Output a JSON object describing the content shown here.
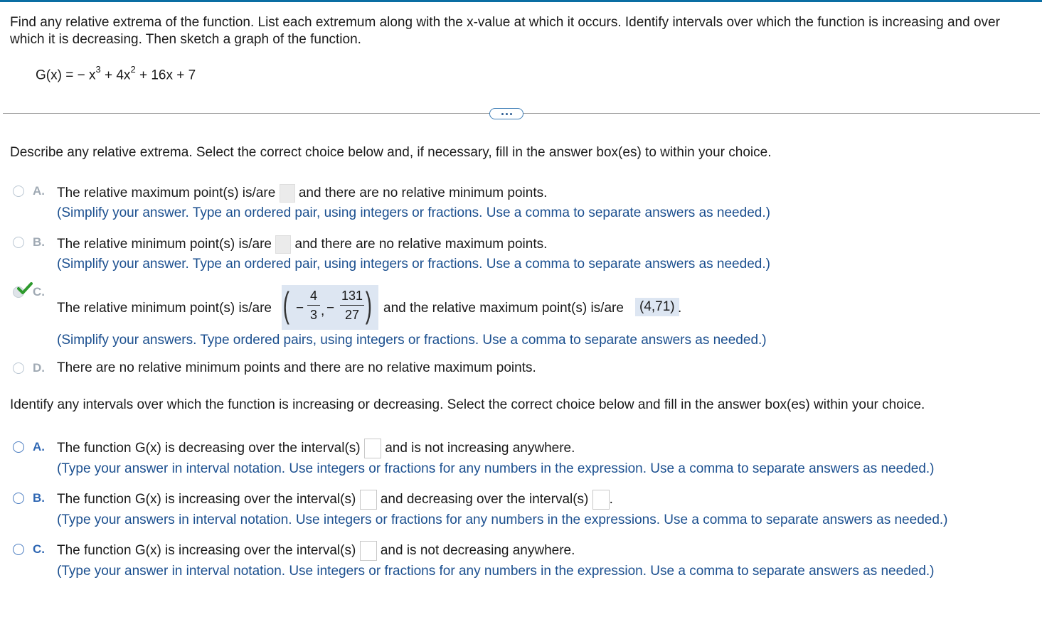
{
  "question": "Find any relative extrema of the function. List each extremum along with the x-value at which it occurs. Identify intervals over which the function is increasing and over which it is decreasing. Then sketch a graph of the function.",
  "formula": {
    "lhs": "G(x) =",
    "term1": "− x",
    "exp1": "3",
    "term2": "+ 4x",
    "exp2": "2",
    "term3": "+ 16x + 7"
  },
  "part1": {
    "prompt": "Describe any relative extrema. Select the correct choice below and, if necessary, fill in the answer box(es) to within your choice.",
    "a": {
      "letter": "A.",
      "pre": "The relative maximum point(s) is/are",
      "post": "and there are no relative minimum points.",
      "hint": "(Simplify your answer. Type an ordered pair, using integers or fractions. Use a comma to separate answers as needed.)"
    },
    "b": {
      "letter": "B.",
      "pre": "The relative minimum point(s) is/are",
      "post": "and there are no relative maximum points.",
      "hint": "(Simplify your answer. Type an ordered pair, using integers or fractions. Use a comma to separate answers as needed.)"
    },
    "c": {
      "letter": "C.",
      "pre": "The relative minimum point(s) is/are",
      "minus1": "−",
      "num1": "4",
      "den1": "3",
      "comma": ",",
      "minus2": "−",
      "num2": "131",
      "den2": "27",
      "mid": "and the relative maximum point(s) is/are",
      "max_value": "(4,71)",
      "end": ".",
      "hint": "(Simplify your answers. Type ordered pairs, using integers or fractions. Use a comma to separate answers as needed.)"
    },
    "d": {
      "letter": "D.",
      "text": "There are no relative minimum points and there are no relative maximum points."
    }
  },
  "part2": {
    "prompt": "Identify any intervals over which the function is increasing or decreasing. Select the correct choice below and fill in the answer box(es) within your choice.",
    "a": {
      "letter": "A.",
      "pre": "The function G(x) is decreasing over the interval(s)",
      "post": "and is not increasing anywhere.",
      "hint": "(Type your answer in interval notation. Use integers or fractions for any numbers in the expression. Use a comma to separate answers as needed.)"
    },
    "b": {
      "letter": "B.",
      "pre": "The function G(x) is increasing over the interval(s)",
      "mid": "and decreasing over the interval(s)",
      "end": ".",
      "hint": "(Type your answers in interval notation. Use integers or fractions for any numbers in the expressions. Use a comma to separate answers as needed.)"
    },
    "c": {
      "letter": "C.",
      "pre": "The function G(x) is increasing over the interval(s)",
      "post": "and is not decreasing anywhere.",
      "hint": "(Type your answer in interval notation. Use integers or fractions for any numbers in the expression. Use a comma to separate answers as needed.)"
    }
  },
  "colors": {
    "accent": "#0a6ea3",
    "hint_text": "#1b4f8f",
    "filled_box": "#dde6f2",
    "check": "#2e9a2e"
  }
}
